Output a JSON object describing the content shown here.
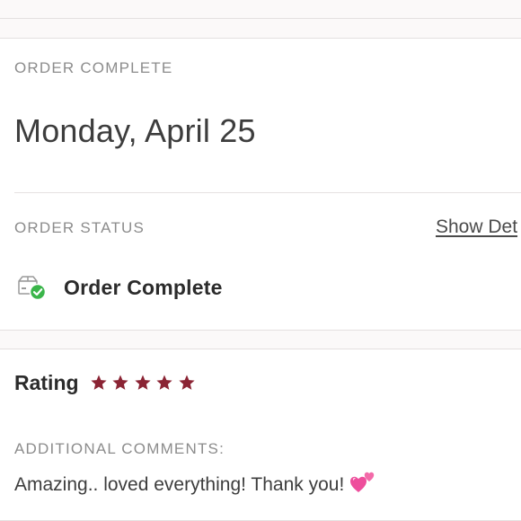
{
  "order_card": {
    "section_label": "ORDER COMPLETE",
    "date": "Monday, April 25",
    "status_label": "ORDER STATUS",
    "show_details_link": "Show Det",
    "status_icon": "package-check-icon",
    "status_text": "Order Complete"
  },
  "rating_card": {
    "rating_label": "Rating",
    "stars": 5,
    "max_stars": 5,
    "star_icon": "star-icon",
    "comments_label": "ADDITIONAL COMMENTS:",
    "comment": "Amazing.. loved everything! Thank you!",
    "comment_emoji_icon": "two-hearts-icon"
  },
  "colors": {
    "star": "#8b2434",
    "check_badge": "#3ab54a",
    "label_gray": "#8c8c8c",
    "page_background": "#fbf9f9",
    "card_background": "#ffffff",
    "heart": "#ee4e9c"
  }
}
